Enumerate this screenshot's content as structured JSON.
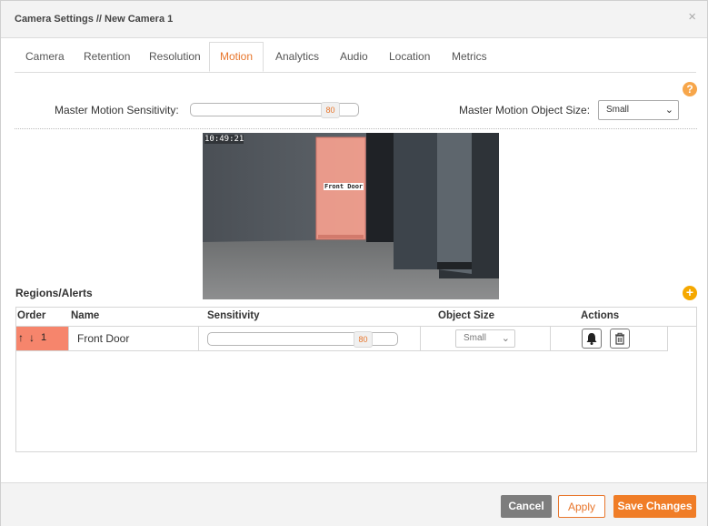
{
  "dialog": {
    "title": "Camera Settings // New Camera 1",
    "close": "×"
  },
  "tabs": [
    {
      "label": "Camera"
    },
    {
      "label": "Retention"
    },
    {
      "label": "Resolution"
    },
    {
      "label": "Motion",
      "active": true
    },
    {
      "label": "Analytics"
    },
    {
      "label": "Audio"
    },
    {
      "label": "Location"
    },
    {
      "label": "Metrics"
    }
  ],
  "motion": {
    "help": "?",
    "master_sensitivity_label": "Master Motion Sensitivity:",
    "master_sensitivity_value": "80",
    "master_object_size_label": "Master Motion Object Size:",
    "master_object_size_value": "Small"
  },
  "video": {
    "timestamp": "10:49:21",
    "region_label": "Front Door"
  },
  "regions": {
    "title": "Regions/Alerts",
    "add": "+",
    "columns": [
      "Order",
      "Name",
      "Sensitivity",
      "Object Size",
      "Actions"
    ],
    "rows": [
      {
        "order": "1",
        "name": "Front Door",
        "sensitivity": "80",
        "object_size": "Small"
      }
    ]
  },
  "footer": {
    "cancel": "Cancel",
    "apply": "Apply",
    "save": "Save Changes"
  },
  "colors": {
    "accent": "#e8762c",
    "order_cell": "#f6856c",
    "cancel_bg": "#7d7d7d"
  }
}
